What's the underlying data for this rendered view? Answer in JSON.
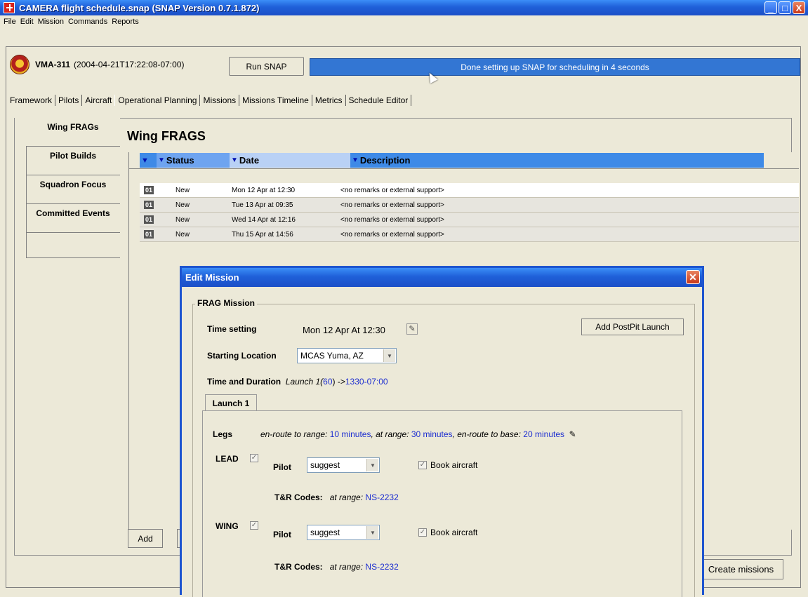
{
  "window": {
    "title": "CAMERA flight schedule.snap (SNAP Version 0.7.1.872)",
    "min": "_",
    "max": "□",
    "close": "X"
  },
  "menu": [
    "File",
    "Edit",
    "Mission",
    "Commands",
    "Reports"
  ],
  "header": {
    "squadron": "VMA-311",
    "datetime": "(2004-04-21T17:22:08-07:00)",
    "run_button": "Run SNAP",
    "status": "Done setting up SNAP for scheduling in 4 seconds"
  },
  "tabs": [
    "Framework",
    "Pilots",
    "Aircraft",
    "Operational Planning",
    "Missions",
    "Missions Timeline",
    "Metrics",
    "Schedule Editor"
  ],
  "side_tabs": [
    "Wing FRAGs",
    "Pilot Builds",
    "Squadron Focus",
    "Committed Events"
  ],
  "wing": {
    "title": "Wing FRAGS",
    "columns": {
      "sel": "▼",
      "status": "Status",
      "date": "Date",
      "description": "Description"
    },
    "rows": [
      {
        "id": "01",
        "status": "New",
        "date": "Mon 12 Apr at 12:30",
        "description": "<no remarks or external support>"
      },
      {
        "id": "01",
        "status": "New",
        "date": "Tue 13 Apr at 09:35",
        "description": "<no remarks or external support>"
      },
      {
        "id": "01",
        "status": "New",
        "date": "Wed 14 Apr at 12:16",
        "description": "<no remarks or external support>"
      },
      {
        "id": "01",
        "status": "New",
        "date": "Thu 15 Apr at 14:56",
        "description": "<no remarks or external support>"
      }
    ],
    "add_button": "Add",
    "create_button": "Create missions"
  },
  "dialog": {
    "title": "Edit Mission",
    "close": "✕",
    "legend": "FRAG Mission",
    "time_setting_label": "Time setting",
    "time_setting_value": "Mon 12 Apr At 12:30",
    "postpit_button": "Add PostPit Launch",
    "starting_location_label": "Starting Location",
    "starting_location_value": "MCAS Yuma, AZ",
    "time_duration_label": "Time and Duration",
    "launch_prefix": "Launch 1(",
    "launch_duration": "60",
    "launch_mid": ") ->",
    "launch_end": "1330-07:00",
    "launch_tab": "Launch 1",
    "legs_label": "Legs",
    "legs": {
      "enroute_label": "en-route to range:",
      "enroute_value": "10 minutes",
      "at_range_label": ", at range:",
      "at_range_value": "30 minutes",
      "to_base_label": ", en-route to base:",
      "to_base_value": "20 minutes"
    },
    "lead": {
      "label": "LEAD",
      "pilot_label": "Pilot",
      "pilot_value": "suggest",
      "book_label": "Book aircraft",
      "tr_label": "T&R Codes:",
      "tr_prefix": "at range:",
      "tr_value": "NS-2232"
    },
    "wing": {
      "label": "WING",
      "pilot_label": "Pilot",
      "pilot_value": "suggest",
      "book_label": "Book aircraft",
      "tr_label": "T&R Codes:",
      "tr_prefix": "at range:",
      "tr_value": "NS-2232"
    }
  }
}
